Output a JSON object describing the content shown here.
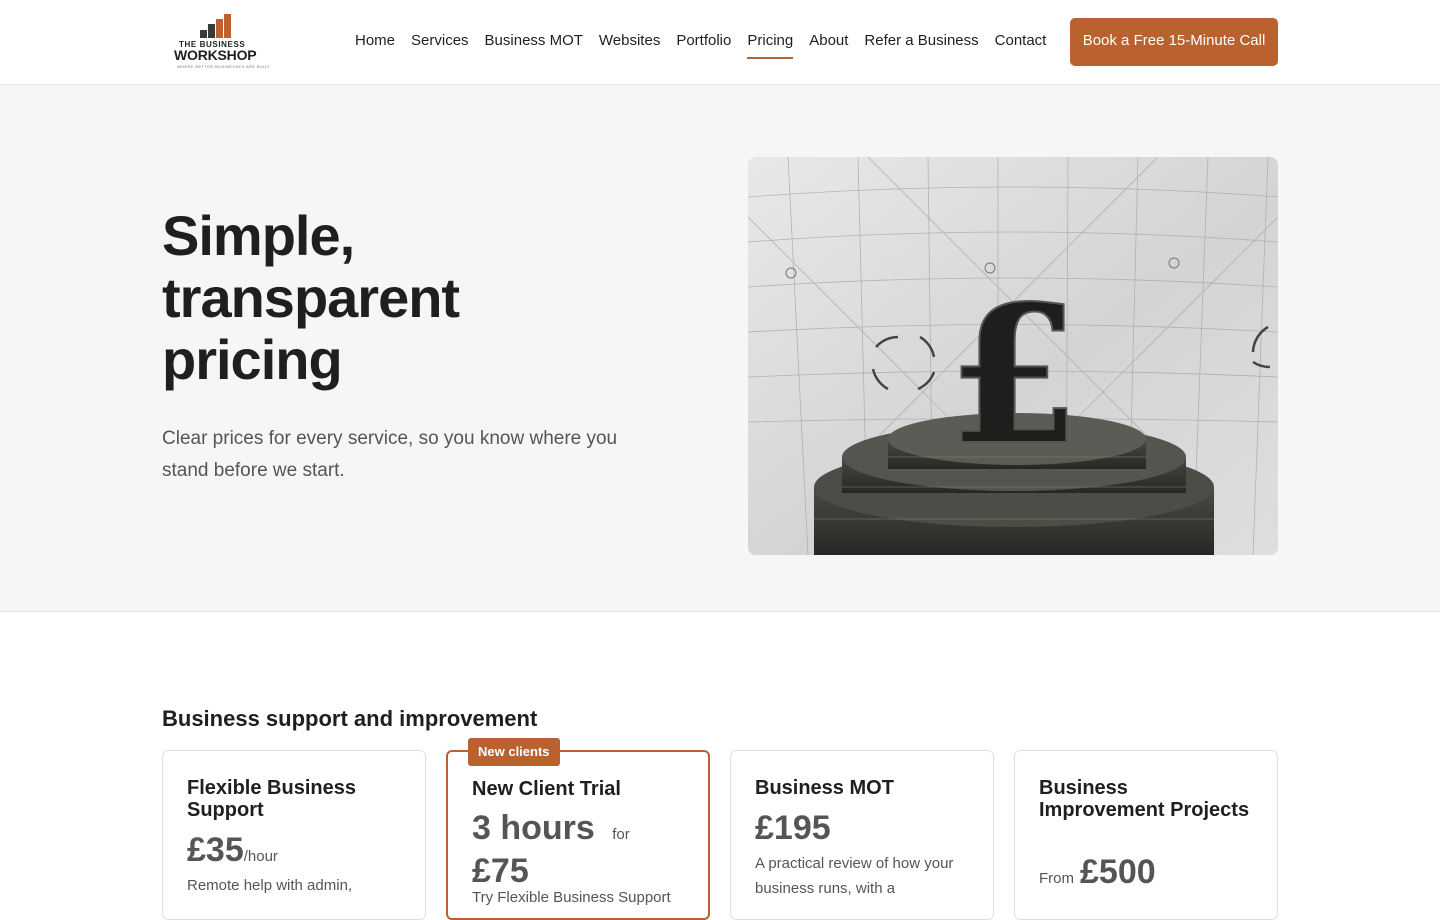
{
  "brand": {
    "logo_top": "THE BUSINESS",
    "logo_main": "WORKSHOP",
    "logo_tag": "WHERE BETTER BUSINESSES ARE BUILT",
    "accent_color": "#b9612f"
  },
  "nav": {
    "items": [
      {
        "label": "Home"
      },
      {
        "label": "Services"
      },
      {
        "label": "Business MOT"
      },
      {
        "label": "Websites"
      },
      {
        "label": "Portfolio"
      },
      {
        "label": "Pricing",
        "active": true
      },
      {
        "label": "About"
      },
      {
        "label": "Refer a Business"
      },
      {
        "label": "Contact"
      }
    ],
    "cta_label": "Book a Free 15-Minute Call"
  },
  "hero": {
    "title": "Simple, transparent pricing",
    "subtitle": "Clear prices for every service, so you know where you stand before we start.",
    "image_icon": "pound-sign-podium-icon"
  },
  "pricing": {
    "section_title": "Business support and improvement",
    "cards": [
      {
        "title": "Flexible Business Support",
        "price": "£35",
        "unit": "/hour",
        "desc": "Remote help with admin,"
      },
      {
        "title": "New Client Trial",
        "badge": "New clients",
        "price_hours": "3 hours",
        "price_for": "for",
        "price": "£75",
        "desc": "Try Flexible Business Support"
      },
      {
        "title": "Business MOT",
        "price": "£195",
        "desc": "A practical review of how your business runs, with a"
      },
      {
        "title": "Business Improvement Projects",
        "from": "From",
        "price": "£500"
      }
    ]
  }
}
